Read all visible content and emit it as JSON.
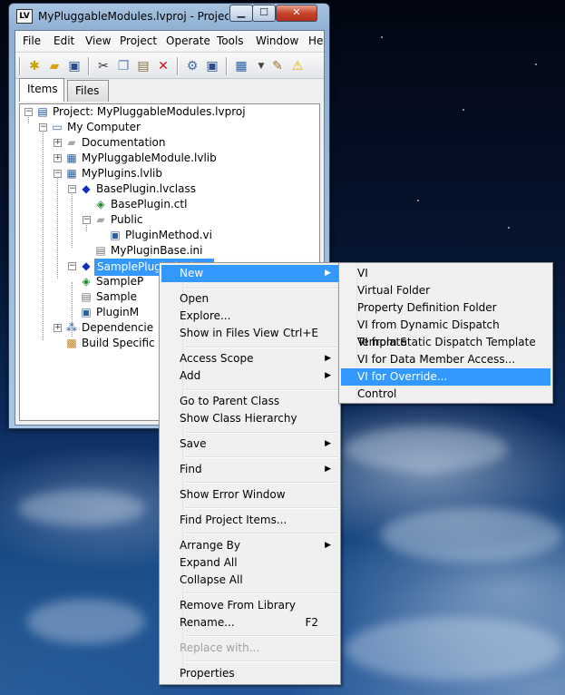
{
  "window": {
    "title": "MyPluggableModules.lvproj - Project ...",
    "minimize_glyph": "▁",
    "maximize_glyph": "☐",
    "close_glyph": "✕"
  },
  "menubar": [
    "File",
    "Edit",
    "View",
    "Project",
    "Operate",
    "Tools",
    "Window",
    "He"
  ],
  "tabs": {
    "items": "Items",
    "files": "Files"
  },
  "tree": [
    {
      "label": "Project: MyPluggableModules.lvproj",
      "icon": "project-icon"
    },
    {
      "label": "My Computer",
      "icon": "computer-icon"
    },
    {
      "label": "Documentation",
      "icon": "folder-icon"
    },
    {
      "label": "MyPluggableModule.lvlib",
      "icon": "library-icon"
    },
    {
      "label": "MyPlugins.lvlib",
      "icon": "library-icon"
    },
    {
      "label": "BasePlugin.lvclass",
      "icon": "class-icon"
    },
    {
      "label": "BasePlugin.ctl",
      "icon": "control-icon"
    },
    {
      "label": "Public",
      "icon": "folder-icon"
    },
    {
      "label": "PluginMethod.vi",
      "icon": "vi-icon"
    },
    {
      "label": "MyPluginBase.ini",
      "icon": "ini-file-icon"
    },
    {
      "label": "SamplePlugin.lvclass",
      "icon": "class-icon"
    },
    {
      "label": "SampleP",
      "icon": "control-icon"
    },
    {
      "label": "Sample",
      "icon": "ini-file-icon"
    },
    {
      "label": "PluginM",
      "icon": "vi-icon"
    },
    {
      "label": "Dependencie",
      "icon": "dependencies-icon"
    },
    {
      "label": "Build Specific",
      "icon": "build-spec-icon"
    }
  ],
  "context_menu": {
    "new": "New",
    "open": "Open",
    "explore": "Explore...",
    "show_in_files": "Show in Files View",
    "show_in_files_shortcut": "Ctrl+E",
    "access_scope": "Access Scope",
    "add": "Add",
    "go_parent": "Go to Parent Class",
    "show_hierarchy": "Show Class Hierarchy",
    "save": "Save",
    "find": "Find",
    "show_error": "Show Error Window",
    "find_project_items": "Find Project Items...",
    "arrange_by": "Arrange By",
    "expand_all": "Expand All",
    "collapse_all": "Collapse All",
    "remove_from_library": "Remove From Library",
    "rename": "Rename...",
    "rename_shortcut": "F2",
    "replace_with": "Replace with...",
    "properties": "Properties"
  },
  "submenu": [
    "VI",
    "Virtual Folder",
    "Property Definition Folder",
    "VI from Dynamic Dispatch Template",
    "VI from Static Dispatch Template",
    "VI for Data Member Access...",
    "VI for Override...",
    "Control"
  ],
  "colors": {
    "highlight": "#3399ff",
    "menu_bg": "#f0f0f0",
    "close_button": "#c8432a"
  }
}
